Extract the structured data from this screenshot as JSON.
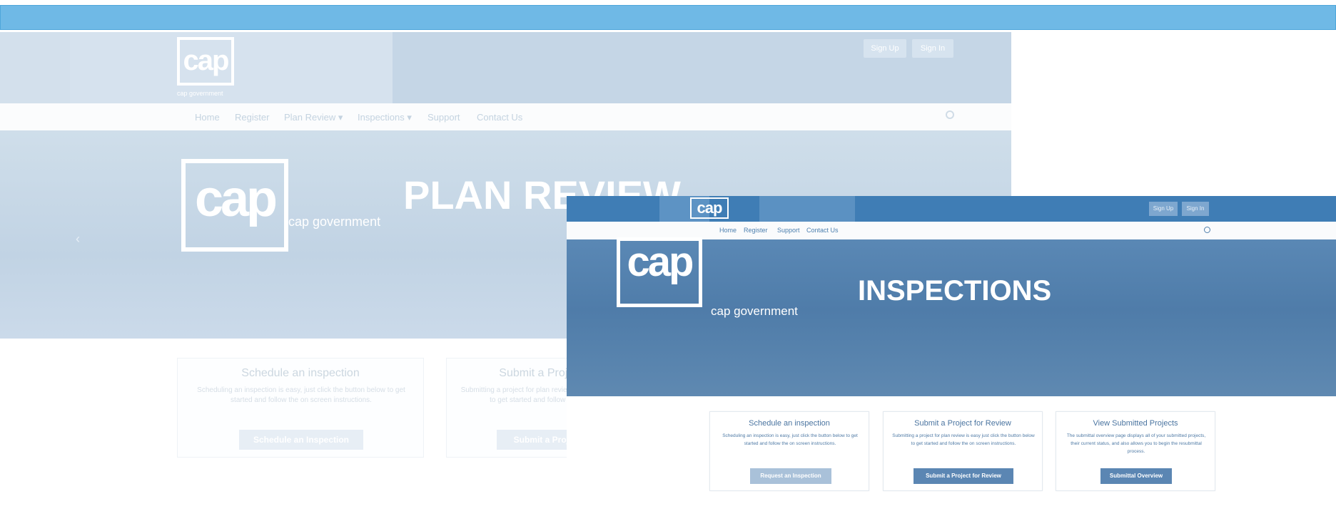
{
  "back": {
    "logo": "cap",
    "logo_sub": "cap government",
    "signup": "Sign Up",
    "signin": "Sign In",
    "nav": [
      "Home",
      "Register",
      "Plan Review ▾",
      "Inspections ▾",
      "Support",
      "Contact Us"
    ],
    "hero_logo": "cap",
    "hero_sub": "cap government",
    "hero_title": "PLAN REVIEW",
    "prev_arrow": "‹",
    "cards": [
      {
        "title": "Schedule an inspection",
        "text": "Scheduling an inspection is easy, just click the button below to get started and follow the on screen instructions.",
        "button": "Schedule an Inspection"
      },
      {
        "title": "Submit a Project for Review",
        "text": "Submitting a project for plan review is easy just click the button below to get started and follow the on screen instructions.",
        "button": "Submit a Project for Review"
      }
    ]
  },
  "front": {
    "logo": "cap",
    "signup": "Sign Up",
    "signin": "Sign In",
    "nav": [
      "Home",
      "Register",
      "Support",
      "Contact Us"
    ],
    "hero_logo": "cap",
    "hero_sub": "cap government",
    "hero_title": "INSPECTIONS",
    "cards": [
      {
        "title": "Schedule an inspection",
        "text": "Scheduling an inspection is easy, just click the button below to get started and follow the on screen instructions.",
        "button": "Request an Inspection",
        "button_color": "#a9c1d9"
      },
      {
        "title": "Submit a Project for Review",
        "text": "Submitting a project for plan review is easy just click the button below to get started and follow the on screen instructions.",
        "button": "Submit a Project for Review",
        "button_color": "#5b86b3"
      },
      {
        "title": "View Submitted Projects",
        "text": "The submittal overview page displays all of your submitted projects, their current status, and also allows you to begin the resubmittal process.",
        "button": "Submittal Overview",
        "button_color": "#5b86b3"
      }
    ]
  },
  "colors": {
    "topbar": "#6fb9e6",
    "front_header": "#3f7db5",
    "front_hero": "#4f7ca9"
  }
}
